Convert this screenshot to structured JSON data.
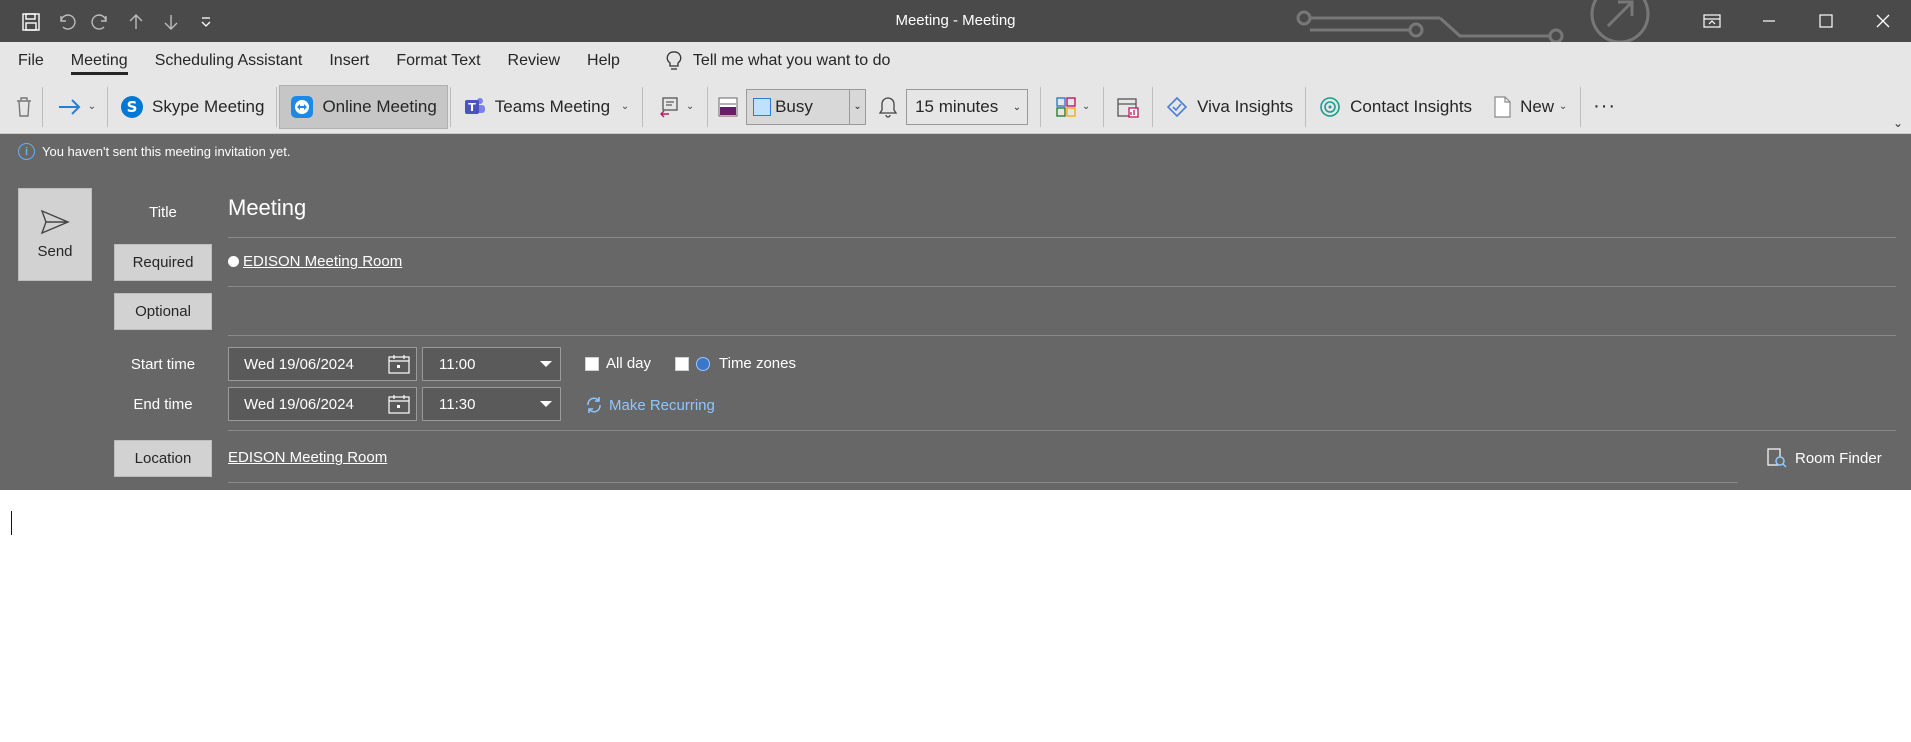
{
  "window": {
    "title": "Meeting  -  Meeting"
  },
  "menu": {
    "items": [
      "File",
      "Meeting",
      "Scheduling Assistant",
      "Insert",
      "Format Text",
      "Review",
      "Help"
    ],
    "active": "Meeting",
    "tell_me": "Tell me what you want to do"
  },
  "ribbon": {
    "skype_meeting": "Skype Meeting",
    "online_meeting": "Online Meeting",
    "teams_meeting": "Teams Meeting",
    "show_as": "Busy",
    "reminder": "15 minutes",
    "viva_insights": "Viva Insights",
    "contact_insights": "Contact Insights",
    "new": "New",
    "more": "···"
  },
  "form": {
    "info_message": "You haven't sent this meeting invitation yet.",
    "send_label": "Send",
    "title_label": "Title",
    "title_value": "Meeting",
    "required_label": "Required",
    "required_attendee": "EDISON Meeting Room",
    "optional_label": "Optional",
    "start_label": "Start time",
    "start_date": "Wed 19/06/2024",
    "start_time": "11:00",
    "end_label": "End time",
    "end_date": "Wed 19/06/2024",
    "end_time": "11:30",
    "all_day_label": "All day",
    "time_zones_label": "Time zones",
    "make_recurring_label": "Make Recurring",
    "location_label": "Location",
    "location_value": "EDISON Meeting Room",
    "room_finder_label": "Room Finder"
  },
  "colors": {
    "titlebar": "#4a4a4a",
    "ribbon": "#e6e6e6",
    "form_bg": "#676767",
    "link_blue": "#8ec7ff"
  }
}
